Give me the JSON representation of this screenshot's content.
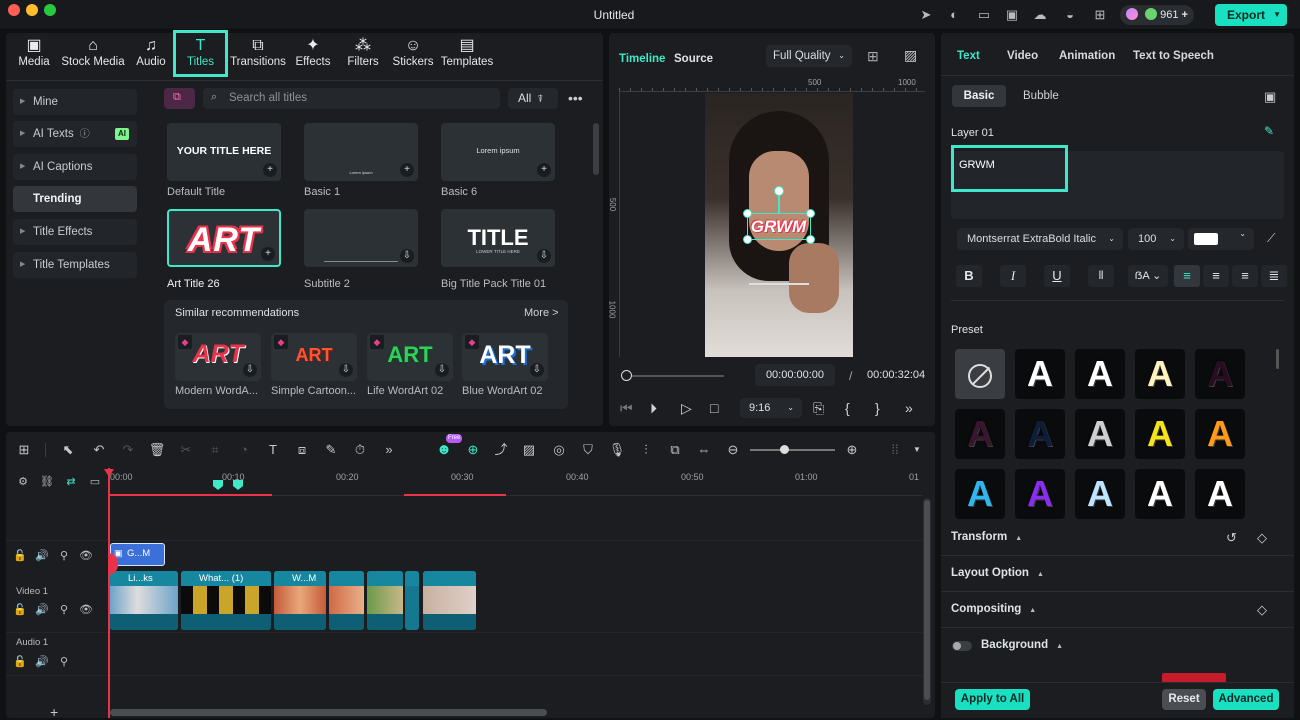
{
  "window": {
    "title": "Untitled",
    "credits": "961",
    "export_label": "Export"
  },
  "media_tabs": [
    {
      "label": "Media",
      "icon": "media-icon"
    },
    {
      "label": "Stock Media",
      "icon": "stock-media-icon"
    },
    {
      "label": "Audio",
      "icon": "audio-icon"
    },
    {
      "label": "Titles",
      "icon": "titles-icon"
    },
    {
      "label": "Transitions",
      "icon": "transitions-icon"
    },
    {
      "label": "Effects",
      "icon": "effects-icon"
    },
    {
      "label": "Filters",
      "icon": "filters-icon"
    },
    {
      "label": "Stickers",
      "icon": "stickers-icon"
    },
    {
      "label": "Templates",
      "icon": "templates-icon"
    }
  ],
  "categories": [
    {
      "label": "Mine"
    },
    {
      "label": "AI Texts",
      "badge": "AI"
    },
    {
      "label": "AI Captions"
    },
    {
      "label": "Trending"
    },
    {
      "label": "Title Effects"
    },
    {
      "label": "Title Templates"
    }
  ],
  "search": {
    "placeholder": "Search all titles",
    "filter": "All"
  },
  "titles": [
    {
      "label": "Default Title",
      "text": "YOUR TITLE HERE"
    },
    {
      "label": "Basic 1",
      "text": "Lorem ipsum"
    },
    {
      "label": "Basic 6",
      "text": "Lorem ipsum"
    },
    {
      "label": "Art Title 26",
      "text": "ART"
    },
    {
      "label": "Subtitle 2",
      "text": ""
    },
    {
      "label": "Big Title Pack Title 01",
      "text": "TITLE",
      "subtext": "LOWER TITLE HERE"
    }
  ],
  "similar": {
    "heading": "Similar recommendations",
    "more": "More >",
    "items": [
      {
        "label": "Modern WordA...",
        "text": "ART",
        "color": "#e8334a"
      },
      {
        "label": "Simple Cartoon...",
        "text": "ART",
        "color": "#ff5533"
      },
      {
        "label": "Life WordArt 02",
        "text": "ART",
        "color": "#2fd15a"
      },
      {
        "label": "Blue WordArt 02",
        "text": "ART",
        "color": "#ffffff"
      }
    ]
  },
  "preview": {
    "tab_timeline": "Timeline",
    "tab_source": "Source",
    "quality": "Full Quality",
    "ruler": [
      "500",
      "1000"
    ],
    "vruler": [
      "500",
      "1000"
    ],
    "overlay_text": "GRWM",
    "current_time": "00:00:00:00",
    "separator": "/",
    "total_time": "00:00:32:04",
    "aspect": "9:16"
  },
  "inspector": {
    "tabs": [
      "Text",
      "Video",
      "Animation",
      "Text to Speech"
    ],
    "subtabs": [
      "Basic",
      "Bubble"
    ],
    "layer": "Layer 01",
    "text_value": "GRWM",
    "font": "Montserrat ExtraBold Italic",
    "size": "100",
    "color": "#ffffff",
    "preset_label": "Preset",
    "presets": [
      {
        "fill": "none"
      },
      {
        "fill": "#ffffff"
      },
      {
        "fill": "#ffffff"
      },
      {
        "fill": "#fff3c0"
      },
      {
        "fill": "#2a0c22"
      },
      {
        "fill": "#3a1530"
      },
      {
        "fill": "#0e1e3a"
      },
      {
        "fill": "#cfcfcf"
      },
      {
        "fill": "#f6e31c"
      },
      {
        "fill": "#ff9a1a"
      },
      {
        "fill": "#2fb6f0"
      },
      {
        "fill": "#8a2cf2"
      },
      {
        "fill": "#bfe4ff"
      },
      {
        "fill": "#ffffff"
      },
      {
        "fill": "#ffffff"
      }
    ],
    "preset_letter": "A",
    "sections": [
      "Transform",
      "Layout Option",
      "Compositing",
      "Background"
    ],
    "apply_all": "Apply to All",
    "reset": "Reset",
    "advanced": "Advanced"
  },
  "timeline": {
    "ruler": [
      "00:00",
      "00:10",
      "00:20",
      "00:30",
      "00:40",
      "00:50",
      "01:00",
      "01"
    ],
    "tracks": [
      "Video 1",
      "Audio 1"
    ],
    "title_clip": "G...M",
    "clips": [
      "Li...ks",
      "What... (1)",
      "W...M",
      "",
      ""
    ],
    "free_badge": "Free"
  }
}
